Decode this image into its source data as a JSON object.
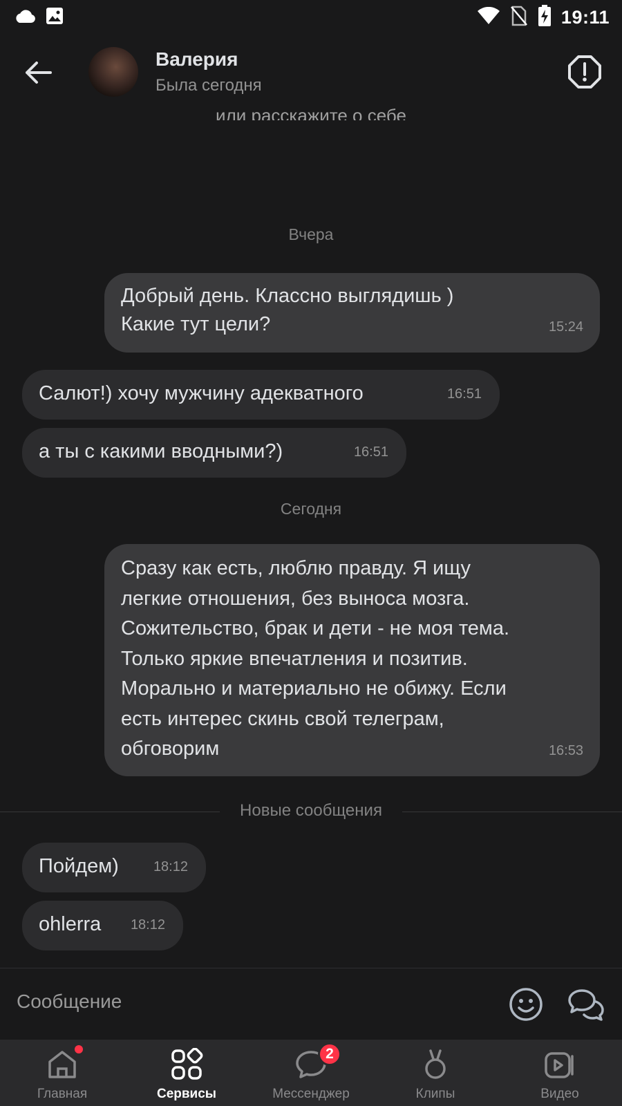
{
  "status_bar": {
    "time": "19:11"
  },
  "header": {
    "name": "Валерия",
    "status": "Была сегодня"
  },
  "cut_text": "или расскажите о себе",
  "date_separators": {
    "yesterday": "Вчера",
    "today": "Сегодня"
  },
  "messages": [
    {
      "direction": "out",
      "text_lines": [
        "Добрый день. Классно выглядишь )",
        "Какие тут цели?"
      ],
      "time": "15:24"
    },
    {
      "direction": "in",
      "text": "Салют!) хочу мужчину адекватного",
      "time": "16:51"
    },
    {
      "direction": "in",
      "text": "а ты с какими вводными?)",
      "time": "16:51"
    },
    {
      "direction": "out",
      "text_lines": [
        "Сразу как есть, люблю правду. Я ищу",
        "легкие отношения, без выноса мозга.",
        "Сожительство, брак и дети - не моя тема.",
        "Только яркие впечатления и позитив.",
        "Морально и материально не обижу. Если",
        "есть интерес скинь свой телеграм,",
        "обговорим"
      ],
      "time": "16:53"
    },
    {
      "direction": "in",
      "text": "Пойдем)",
      "time": "18:12"
    },
    {
      "direction": "in",
      "text": "ohlerra",
      "time": "18:12"
    }
  ],
  "new_messages_label": "Новые сообщения",
  "composer": {
    "placeholder": "Сообщение"
  },
  "tabbar": {
    "items": [
      {
        "label": "Главная",
        "icon": "home-icon",
        "has_dot": true
      },
      {
        "label": "Сервисы",
        "icon": "services-icon",
        "active": true
      },
      {
        "label": "Мессенджер",
        "icon": "messenger-icon",
        "badge": "2"
      },
      {
        "label": "Клипы",
        "icon": "clips-icon"
      },
      {
        "label": "Видео",
        "icon": "video-icon"
      }
    ]
  },
  "colors": {
    "background": "#19191a",
    "bubble_out": "#3a3a3c",
    "bubble_in": "#2c2c2e",
    "badge": "#ff3347"
  }
}
